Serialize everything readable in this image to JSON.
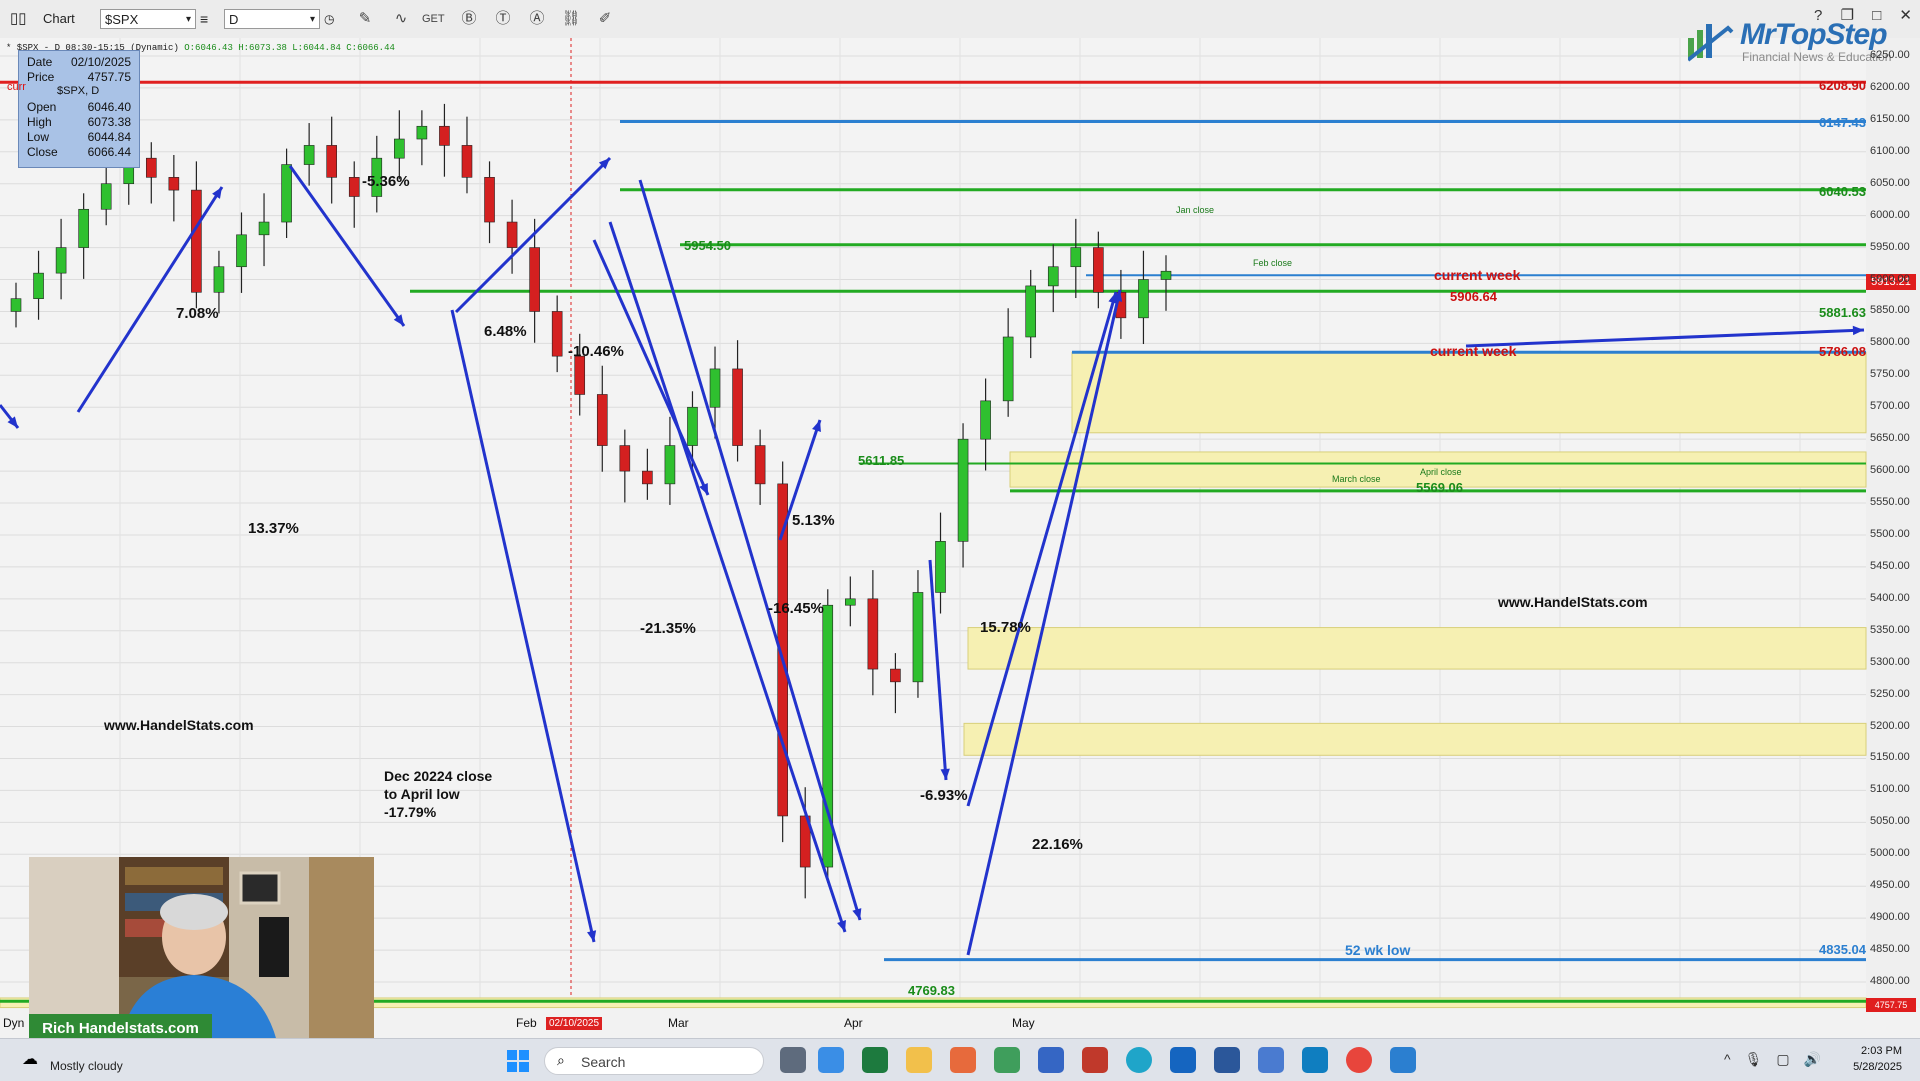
{
  "toolbar": {
    "app_title": "Chart",
    "symbol": "$SPX",
    "interval": "D",
    "get_label": "GET",
    "icons": [
      "pencil-icon",
      "wave-icon",
      "get-icon",
      "b-circle-icon",
      "t-circle-icon",
      "a-circle-icon",
      "link-icon",
      "edit-icon"
    ]
  },
  "window_controls": [
    "help-icon",
    "restore-icon",
    "maximize-icon",
    "close-icon"
  ],
  "status_line": {
    "prefix": "* $SPX - D",
    "session": "08:30-15:15 (Dynamic)",
    "ohlc": "O:6046.43 H:6073.38 L:6044.84 C:6066.44"
  },
  "info_box": {
    "date_label": "Date",
    "date": "02/10/2025",
    "price_label": "Price",
    "price": "4757.75",
    "symbol": "$SPX, D",
    "current_fragment": "curr",
    "open_label": "Open",
    "open": "6046.40",
    "high_label": "High",
    "high": "6073.38",
    "low_label": "Low",
    "low": "6044.84",
    "close_label": "Close",
    "close": "6066.44"
  },
  "logo": {
    "name": "MrTopStep",
    "tagline": "Financial News & Education"
  },
  "annotations": {
    "pct_536": "-5.36%",
    "pct_708": "7.08%",
    "pct_648": "6.48%",
    "pct_1046": "-10.46%",
    "pct_1337": "13.37%",
    "pct_2135": "-21.35%",
    "pct_1645": "-16.45%",
    "pct_513": "5.13%",
    "pct_1578": "15.78%",
    "pct_693": "-6.93%",
    "pct_2216": "22.16%",
    "dec_line1": "Dec 20224 close",
    "dec_line2": "to April low",
    "dec_line3": "-17.79%",
    "website1": "www.HandelStats.com",
    "website2": "www.HandelStats.com",
    "current_week_1": "current week",
    "current_week_2": "current week",
    "low_52wk": "52 wk low",
    "jan_close": "Jan close",
    "feb_close": "Feb close",
    "march_close": "March close",
    "april_close": "April close",
    "lvl_5954": "5954.50",
    "lvl_5611": "5611.85",
    "lvl_5569": "5569.06",
    "lvl_4769": "4769.83",
    "lvl_5906": "5906.64"
  },
  "levels": {
    "l6208": "6208.90",
    "l6147": "6147.43",
    "l6040": "6040.53",
    "l5881": "5881.63",
    "l5786": "5786.08",
    "l4835": "4835.04"
  },
  "colors": {
    "red_line": "#e02020",
    "blue_line": "#2b7fd0",
    "green_line": "#22aa22",
    "arrow": "#2233cc",
    "zone": "#f6f0b2"
  },
  "price_tag": "5913.21",
  "price_tag_low": "4757.75",
  "x_axis": {
    "dyn": "Dyn",
    "feb": "Feb",
    "mar": "Mar",
    "apr": "Apr",
    "may": "May",
    "date_marker": "02/10/2025"
  },
  "chart_data": {
    "type": "candlestick",
    "symbol": "$SPX",
    "interval": "D",
    "ylim": [
      4750,
      6275
    ],
    "y_ticks": [
      6250,
      6200,
      6150,
      6100,
      6050,
      6000,
      5950,
      5900,
      5850,
      5800,
      5750,
      5700,
      5650,
      5600,
      5550,
      5500,
      5450,
      5400,
      5350,
      5300,
      5250,
      5200,
      5150,
      5100,
      5050,
      5000,
      4950,
      4900,
      4850,
      4800
    ],
    "x_months": [
      "Feb",
      "Mar",
      "Apr",
      "May"
    ],
    "horizontal_levels": [
      6208.9,
      6147.43,
      6040.53,
      5954.5,
      5906.64,
      5881.63,
      5786.08,
      5611.85,
      5569.06,
      4835.04,
      4769.83
    ],
    "ohlc_close_sequence_estimate": [
      5870,
      5910,
      5950,
      6010,
      6050,
      6090,
      6060,
      6040,
      5880,
      5920,
      5970,
      5990,
      6080,
      6110,
      6060,
      6030,
      6090,
      6120,
      6140,
      6110,
      6060,
      5990,
      5950,
      5850,
      5780,
      5720,
      5640,
      5600,
      5580,
      5640,
      5700,
      5760,
      5640,
      5580,
      5060,
      4980,
      5390,
      5400,
      5290,
      5270,
      5410,
      5490,
      5650,
      5710,
      5810,
      5890,
      5920,
      5950,
      5880,
      5840,
      5900,
      5913
    ]
  },
  "webcam_caption": "Rich Handelstats.com",
  "taskbar": {
    "weather_temp": "Mostly cloudy",
    "search_placeholder": "Search",
    "time": "2:03 PM",
    "date": "5/28/2025"
  }
}
